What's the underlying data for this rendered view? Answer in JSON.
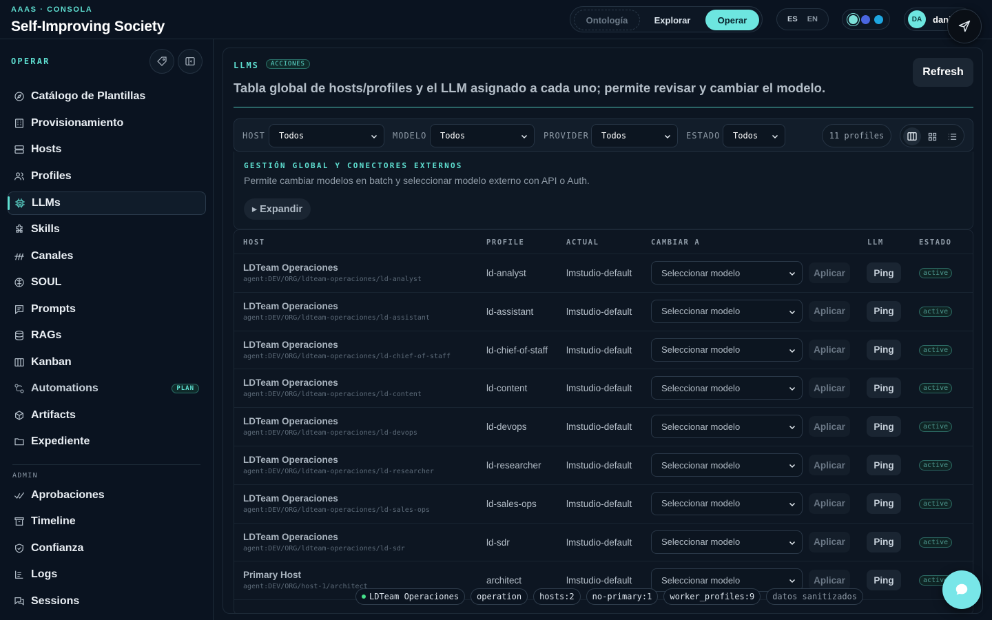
{
  "header": {
    "kicker": "AAAS · CONSOLA",
    "title": "Self-Improving Society",
    "modes": [
      "Ontología",
      "Explorar",
      "Operar"
    ],
    "active_mode": "Operar",
    "langs": [
      "ES",
      "EN"
    ],
    "theme_dots": [
      "#7de0d8",
      "#4a66e0",
      "#1ea6e0"
    ],
    "user": {
      "initials": "DA",
      "name": "dani"
    }
  },
  "sidebar": {
    "section": "OPERAR",
    "items": [
      {
        "label": "Catálogo de Plantillas",
        "icon": "compass-icon"
      },
      {
        "label": "Provisionamiento",
        "icon": "building-icon"
      },
      {
        "label": "Hosts",
        "icon": "server-icon"
      },
      {
        "label": "Profiles",
        "icon": "users-icon"
      },
      {
        "label": "LLMs",
        "icon": "cpu-icon",
        "active": true
      },
      {
        "label": "Skills",
        "icon": "puzzle-icon"
      },
      {
        "label": "Canales",
        "icon": "antenna-icon"
      },
      {
        "label": "SOUL",
        "icon": "brain-icon"
      },
      {
        "label": "Prompts",
        "icon": "message-icon"
      },
      {
        "label": "RAGs",
        "icon": "database-icon"
      },
      {
        "label": "Kanban",
        "icon": "columns-icon"
      },
      {
        "label": "Automations",
        "icon": "workflow-icon",
        "badge": "PLAN"
      },
      {
        "label": "Artifacts",
        "icon": "package-icon"
      },
      {
        "label": "Expediente",
        "icon": "folder-icon"
      }
    ],
    "admin_title": "ADMIN",
    "admin_items": [
      {
        "label": "Aprobaciones",
        "icon": "check-icon"
      },
      {
        "label": "Timeline",
        "icon": "archive-icon"
      },
      {
        "label": "Confianza",
        "icon": "shield-icon"
      },
      {
        "label": "Logs",
        "icon": "logs-icon"
      },
      {
        "label": "Sessions",
        "icon": "chat-icon"
      }
    ]
  },
  "main": {
    "section": "LLMS",
    "badge": "ACCIONES",
    "description": "Tabla global de hosts/profiles y el LLM asignado a cada uno; permite revisar y cambiar el modelo.",
    "refresh_label": "Refresh",
    "filters": {
      "host": {
        "label": "HOST",
        "value": "Todos"
      },
      "model": {
        "label": "MODELO",
        "value": "Todos"
      },
      "provider": {
        "label": "PROVIDER",
        "value": "Todos"
      },
      "state": {
        "label": "ESTADO",
        "value": "Todos"
      },
      "count": "11 profiles"
    },
    "global": {
      "title": "GESTIÓN GLOBAL Y CONECTORES EXTERNOS",
      "description": "Permite cambiar modelos en batch y seleccionar modelo externo con API o Auth.",
      "expand_label": "▸ Expandir"
    },
    "table": {
      "columns": [
        "HOST",
        "PROFILE",
        "ACTUAL",
        "CAMBIAR A",
        "LLM",
        "ESTADO"
      ],
      "select_placeholder": "Seleccionar modelo",
      "apply_label": "Aplicar",
      "ping_label": "Ping",
      "rows": [
        {
          "host": "LDTeam Operaciones",
          "path": "agent:DEV/ORG/ldteam-operaciones/ld-analyst",
          "profile": "ld-analyst",
          "actual": "lmstudio-default",
          "state": "active"
        },
        {
          "host": "LDTeam Operaciones",
          "path": "agent:DEV/ORG/ldteam-operaciones/ld-assistant",
          "profile": "ld-assistant",
          "actual": "lmstudio-default",
          "state": "active"
        },
        {
          "host": "LDTeam Operaciones",
          "path": "agent:DEV/ORG/ldteam-operaciones/ld-chief-of-staff",
          "profile": "ld-chief-of-staff",
          "actual": "lmstudio-default",
          "state": "active"
        },
        {
          "host": "LDTeam Operaciones",
          "path": "agent:DEV/ORG/ldteam-operaciones/ld-content",
          "profile": "ld-content",
          "actual": "lmstudio-default",
          "state": "active"
        },
        {
          "host": "LDTeam Operaciones",
          "path": "agent:DEV/ORG/ldteam-operaciones/ld-devops",
          "profile": "ld-devops",
          "actual": "lmstudio-default",
          "state": "active"
        },
        {
          "host": "LDTeam Operaciones",
          "path": "agent:DEV/ORG/ldteam-operaciones/ld-researcher",
          "profile": "ld-researcher",
          "actual": "lmstudio-default",
          "state": "active"
        },
        {
          "host": "LDTeam Operaciones",
          "path": "agent:DEV/ORG/ldteam-operaciones/ld-sales-ops",
          "profile": "ld-sales-ops",
          "actual": "lmstudio-default",
          "state": "active"
        },
        {
          "host": "LDTeam Operaciones",
          "path": "agent:DEV/ORG/ldteam-operaciones/ld-sdr",
          "profile": "ld-sdr",
          "actual": "lmstudio-default",
          "state": "active"
        },
        {
          "host": "Primary Host",
          "path": "agent:DEV/ORG/host-1/architect",
          "profile": "architect",
          "actual": "lmstudio-default",
          "state": "active"
        }
      ]
    }
  },
  "footer_chips": [
    "LDTeam Operaciones",
    "operation",
    "hosts:2",
    "no-primary:1",
    "worker_profiles:9",
    "datos sanitizados"
  ]
}
